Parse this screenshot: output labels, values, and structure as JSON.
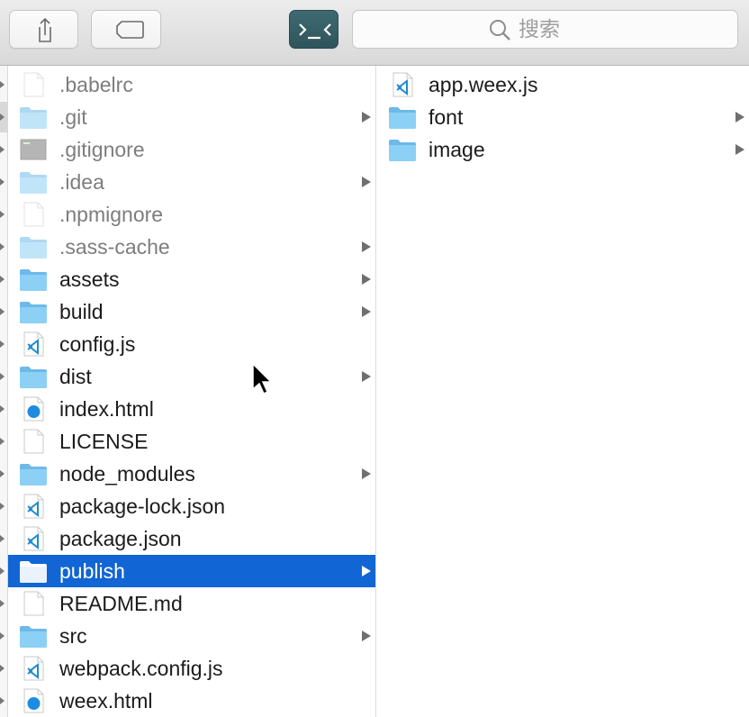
{
  "toolbar": {
    "share_icon": "share-icon",
    "tags_icon": "tag-icon",
    "path_icon": "terminal-icon",
    "search_placeholder": "搜索"
  },
  "colors": {
    "selection": "#1165d4",
    "folder": "#6cb9ea",
    "hidden_text": "#7d7d7d",
    "text": "#1b1b1b"
  },
  "column1": {
    "items": [
      {
        "name": ".babelrc",
        "kind": "file",
        "hidden": true,
        "has_children": false
      },
      {
        "name": ".git",
        "kind": "folder",
        "hidden": true,
        "has_children": true
      },
      {
        "name": ".gitignore",
        "kind": "text",
        "hidden": true,
        "has_children": false
      },
      {
        "name": ".idea",
        "kind": "folder",
        "hidden": true,
        "has_children": true
      },
      {
        "name": ".npmignore",
        "kind": "file",
        "hidden": true,
        "has_children": false
      },
      {
        "name": ".sass-cache",
        "kind": "folder",
        "hidden": true,
        "has_children": true
      },
      {
        "name": "assets",
        "kind": "folder",
        "hidden": false,
        "has_children": true
      },
      {
        "name": "build",
        "kind": "folder",
        "hidden": false,
        "has_children": true
      },
      {
        "name": "config.js",
        "kind": "vscode",
        "hidden": false,
        "has_children": false
      },
      {
        "name": "dist",
        "kind": "folder",
        "hidden": false,
        "has_children": true
      },
      {
        "name": "index.html",
        "kind": "html",
        "hidden": false,
        "has_children": false
      },
      {
        "name": "LICENSE",
        "kind": "file",
        "hidden": false,
        "has_children": false
      },
      {
        "name": "node_modules",
        "kind": "folder",
        "hidden": false,
        "has_children": true
      },
      {
        "name": "package-lock.json",
        "kind": "vscode",
        "hidden": false,
        "has_children": false
      },
      {
        "name": "package.json",
        "kind": "vscode",
        "hidden": false,
        "has_children": false
      },
      {
        "name": "publish",
        "kind": "folder",
        "hidden": false,
        "has_children": true,
        "selected": true
      },
      {
        "name": "README.md",
        "kind": "file",
        "hidden": false,
        "has_children": false
      },
      {
        "name": "src",
        "kind": "folder",
        "hidden": false,
        "has_children": true
      },
      {
        "name": "webpack.config.js",
        "kind": "vscode",
        "hidden": false,
        "has_children": false
      },
      {
        "name": "weex.html",
        "kind": "html",
        "hidden": false,
        "has_children": false
      }
    ]
  },
  "column2": {
    "items": [
      {
        "name": "app.weex.js",
        "kind": "vscode",
        "hidden": false,
        "has_children": false
      },
      {
        "name": "font",
        "kind": "folder",
        "hidden": false,
        "has_children": true
      },
      {
        "name": "image",
        "kind": "folder",
        "hidden": false,
        "has_children": true
      }
    ]
  }
}
